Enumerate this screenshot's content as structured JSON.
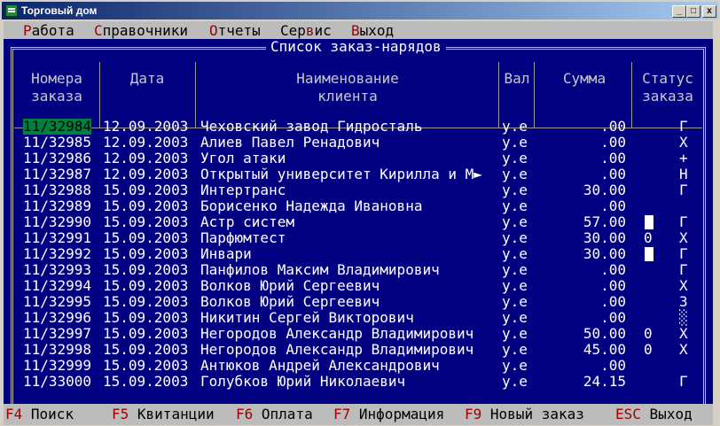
{
  "window": {
    "title": "Торговый дом",
    "min_label": "_",
    "max_label": "□",
    "close_label": "x"
  },
  "menu": [
    {
      "label": "Работа",
      "hotkey_char": "Р"
    },
    {
      "label": "Справочники",
      "hotkey_char": "С"
    },
    {
      "label": "Отчеты",
      "hotkey_char": "О"
    },
    {
      "label": "Сервис",
      "hotkey_char": "в"
    },
    {
      "label": "Выход",
      "hotkey_char": "В"
    }
  ],
  "list": {
    "title": "Список заказ-нарядов",
    "headers": {
      "order_num_1": "Номера",
      "order_num_2": "заказа",
      "date": "Дата",
      "client_1": "Наименование",
      "client_2": "клиента",
      "currency": "Вал",
      "amount": "Сумма",
      "status_1": "Статус",
      "status_2": "заказа"
    },
    "rows": [
      {
        "num": "11/32984",
        "date": "12.09.2003",
        "client": "Чеховский завод Гидросталь",
        "cur": "у.е",
        "amount": ".00",
        "flag": "",
        "status": "Г",
        "selected": true
      },
      {
        "num": "11/32985",
        "date": "12.09.2003",
        "client": "Алиев Павел Ренадович",
        "cur": "у.е",
        "amount": ".00",
        "flag": "",
        "status": "Х"
      },
      {
        "num": "11/32986",
        "date": "12.09.2003",
        "client": "Угол атаки",
        "cur": "у.е",
        "amount": ".00",
        "flag": "",
        "status": "+"
      },
      {
        "num": "11/32987",
        "date": "12.09.2003",
        "client": "Открытый университет Кирилла и М►",
        "cur": "у.е",
        "amount": ".00",
        "flag": "",
        "status": "Н"
      },
      {
        "num": "11/32988",
        "date": "15.09.2003",
        "client": "Интертранс",
        "cur": "у.е",
        "amount": "30.00",
        "flag": "",
        "status": "Г"
      },
      {
        "num": "11/32989",
        "date": "15.09.2003",
        "client": "Борисенко Надежда Ивановна",
        "cur": "у.е",
        "amount": ".00",
        "flag": "",
        "status": ""
      },
      {
        "num": "11/32990",
        "date": "15.09.2003",
        "client": "Астр систем",
        "cur": "у.е",
        "amount": "57.00",
        "flag": "block",
        "status": "Г"
      },
      {
        "num": "11/32991",
        "date": "15.09.2003",
        "client": "Парфюмтест",
        "cur": "у.е",
        "amount": "30.00",
        "flag": "0",
        "status": "Х"
      },
      {
        "num": "11/32992",
        "date": "15.09.2003",
        "client": "Инвари",
        "cur": "у.е",
        "amount": "30.00",
        "flag": "block",
        "status": "Г"
      },
      {
        "num": "11/32993",
        "date": "15.09.2003",
        "client": "Панфилов Максим Владимирович",
        "cur": "у.е",
        "amount": ".00",
        "flag": "",
        "status": "Г"
      },
      {
        "num": "11/32994",
        "date": "15.09.2003",
        "client": "Волков Юрий Сергеевич",
        "cur": "у.е",
        "amount": ".00",
        "flag": "",
        "status": "Х"
      },
      {
        "num": "11/32995",
        "date": "15.09.2003",
        "client": "Волков Юрий Сергеевич",
        "cur": "у.е",
        "amount": ".00",
        "flag": "",
        "status": "З"
      },
      {
        "num": "11/32996",
        "date": "15.09.2003",
        "client": "Никитин Сергей Викторович",
        "cur": "у.е",
        "amount": ".00",
        "flag": "",
        "status": "░"
      },
      {
        "num": "11/32997",
        "date": "15.09.2003",
        "client": "Негородов Александр Владимирович",
        "cur": "у.е",
        "amount": "50.00",
        "flag": "0",
        "status": "Х"
      },
      {
        "num": "11/32998",
        "date": "15.09.2003",
        "client": "Негородов Александр Владимирович",
        "cur": "у.е",
        "amount": "45.00",
        "flag": "0",
        "status": "Х"
      },
      {
        "num": "11/32999",
        "date": "15.09.2003",
        "client": "Антюков Андрей Александрович",
        "cur": "у.е",
        "amount": ".00",
        "flag": "",
        "status": ""
      },
      {
        "num": "11/33000",
        "date": "15.09.2003",
        "client": "Голубков Юрий Николаевич",
        "cur": "у.е",
        "amount": "24.15",
        "flag": "",
        "status": "Г"
      }
    ]
  },
  "fkeys": [
    {
      "key": "F4",
      "label": "Поиск"
    },
    {
      "key": "F5",
      "label": "Квитанции"
    },
    {
      "key": "F6",
      "label": "Оплата"
    },
    {
      "key": "F7",
      "label": "Информация"
    },
    {
      "key": "F9",
      "label": "Новый заказ"
    },
    {
      "key": "ESC",
      "label": "Выход"
    }
  ],
  "colors": {
    "console_bg": "#000080",
    "selection": "#008040",
    "hotkey": "#a00000"
  }
}
